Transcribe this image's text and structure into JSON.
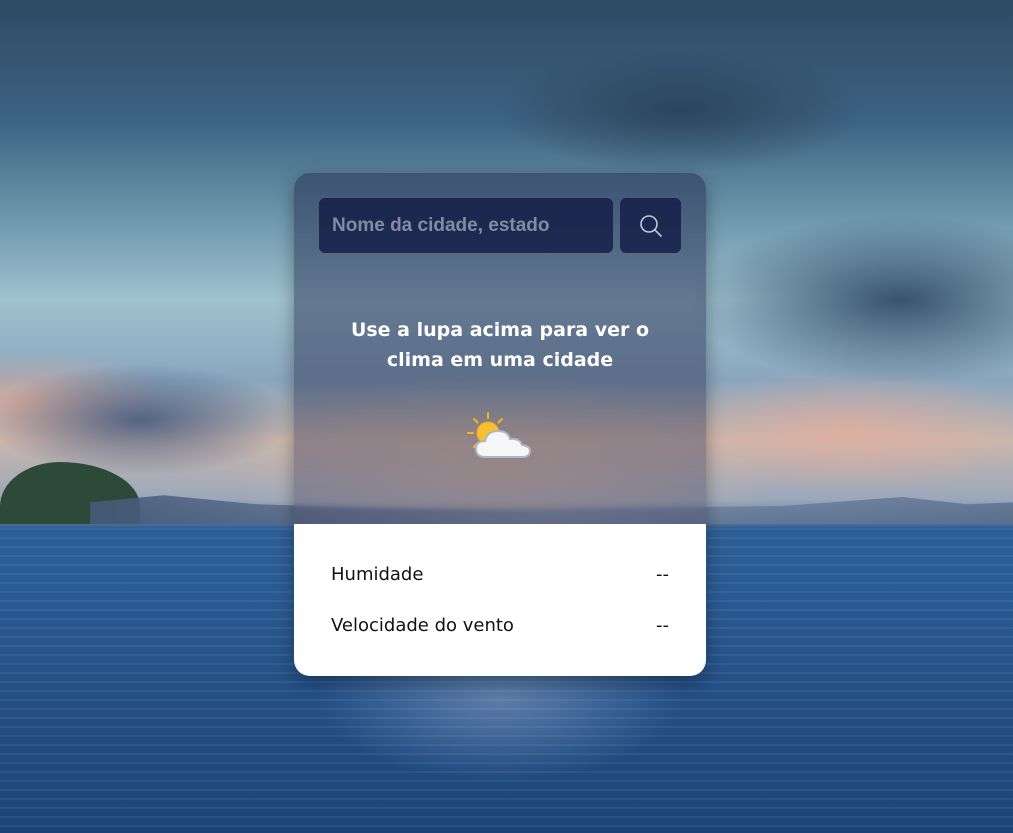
{
  "search": {
    "placeholder": "Nome da cidade, estado",
    "button_icon": "search-icon"
  },
  "main": {
    "message": "Use a lupa acima para ver o clima em uma cidade",
    "weather_icon": "partly-cloudy-icon"
  },
  "details": {
    "humidity_label": "Humidade",
    "humidity_value": "--",
    "wind_label": "Velocidade do vento",
    "wind_value": "--"
  },
  "colors": {
    "panel": "#1c2446",
    "bottom_panel": "#ffffff",
    "text_light": "#ffffff",
    "text_dark": "#111111"
  }
}
